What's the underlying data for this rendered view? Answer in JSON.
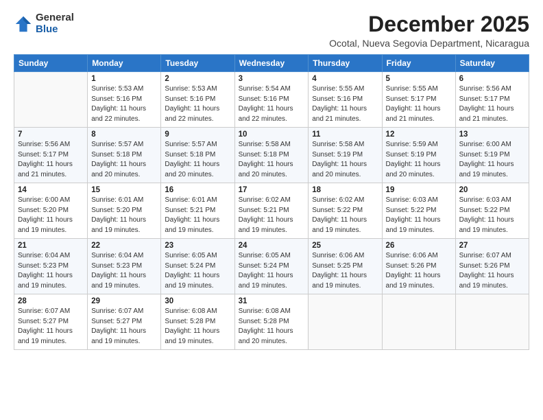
{
  "logo": {
    "general": "General",
    "blue": "Blue"
  },
  "title": "December 2025",
  "location": "Ocotal, Nueva Segovia Department, Nicaragua",
  "days_header": [
    "Sunday",
    "Monday",
    "Tuesday",
    "Wednesday",
    "Thursday",
    "Friday",
    "Saturday"
  ],
  "weeks": [
    [
      {
        "day": "",
        "info": ""
      },
      {
        "day": "1",
        "info": "Sunrise: 5:53 AM\nSunset: 5:16 PM\nDaylight: 11 hours\nand 22 minutes."
      },
      {
        "day": "2",
        "info": "Sunrise: 5:53 AM\nSunset: 5:16 PM\nDaylight: 11 hours\nand 22 minutes."
      },
      {
        "day": "3",
        "info": "Sunrise: 5:54 AM\nSunset: 5:16 PM\nDaylight: 11 hours\nand 22 minutes."
      },
      {
        "day": "4",
        "info": "Sunrise: 5:55 AM\nSunset: 5:16 PM\nDaylight: 11 hours\nand 21 minutes."
      },
      {
        "day": "5",
        "info": "Sunrise: 5:55 AM\nSunset: 5:17 PM\nDaylight: 11 hours\nand 21 minutes."
      },
      {
        "day": "6",
        "info": "Sunrise: 5:56 AM\nSunset: 5:17 PM\nDaylight: 11 hours\nand 21 minutes."
      }
    ],
    [
      {
        "day": "7",
        "info": "Sunrise: 5:56 AM\nSunset: 5:17 PM\nDaylight: 11 hours\nand 21 minutes."
      },
      {
        "day": "8",
        "info": "Sunrise: 5:57 AM\nSunset: 5:18 PM\nDaylight: 11 hours\nand 20 minutes."
      },
      {
        "day": "9",
        "info": "Sunrise: 5:57 AM\nSunset: 5:18 PM\nDaylight: 11 hours\nand 20 minutes."
      },
      {
        "day": "10",
        "info": "Sunrise: 5:58 AM\nSunset: 5:18 PM\nDaylight: 11 hours\nand 20 minutes."
      },
      {
        "day": "11",
        "info": "Sunrise: 5:58 AM\nSunset: 5:19 PM\nDaylight: 11 hours\nand 20 minutes."
      },
      {
        "day": "12",
        "info": "Sunrise: 5:59 AM\nSunset: 5:19 PM\nDaylight: 11 hours\nand 20 minutes."
      },
      {
        "day": "13",
        "info": "Sunrise: 6:00 AM\nSunset: 5:19 PM\nDaylight: 11 hours\nand 19 minutes."
      }
    ],
    [
      {
        "day": "14",
        "info": "Sunrise: 6:00 AM\nSunset: 5:20 PM\nDaylight: 11 hours\nand 19 minutes."
      },
      {
        "day": "15",
        "info": "Sunrise: 6:01 AM\nSunset: 5:20 PM\nDaylight: 11 hours\nand 19 minutes."
      },
      {
        "day": "16",
        "info": "Sunrise: 6:01 AM\nSunset: 5:21 PM\nDaylight: 11 hours\nand 19 minutes."
      },
      {
        "day": "17",
        "info": "Sunrise: 6:02 AM\nSunset: 5:21 PM\nDaylight: 11 hours\nand 19 minutes."
      },
      {
        "day": "18",
        "info": "Sunrise: 6:02 AM\nSunset: 5:22 PM\nDaylight: 11 hours\nand 19 minutes."
      },
      {
        "day": "19",
        "info": "Sunrise: 6:03 AM\nSunset: 5:22 PM\nDaylight: 11 hours\nand 19 minutes."
      },
      {
        "day": "20",
        "info": "Sunrise: 6:03 AM\nSunset: 5:22 PM\nDaylight: 11 hours\nand 19 minutes."
      }
    ],
    [
      {
        "day": "21",
        "info": "Sunrise: 6:04 AM\nSunset: 5:23 PM\nDaylight: 11 hours\nand 19 minutes."
      },
      {
        "day": "22",
        "info": "Sunrise: 6:04 AM\nSunset: 5:23 PM\nDaylight: 11 hours\nand 19 minutes."
      },
      {
        "day": "23",
        "info": "Sunrise: 6:05 AM\nSunset: 5:24 PM\nDaylight: 11 hours\nand 19 minutes."
      },
      {
        "day": "24",
        "info": "Sunrise: 6:05 AM\nSunset: 5:24 PM\nDaylight: 11 hours\nand 19 minutes."
      },
      {
        "day": "25",
        "info": "Sunrise: 6:06 AM\nSunset: 5:25 PM\nDaylight: 11 hours\nand 19 minutes."
      },
      {
        "day": "26",
        "info": "Sunrise: 6:06 AM\nSunset: 5:26 PM\nDaylight: 11 hours\nand 19 minutes."
      },
      {
        "day": "27",
        "info": "Sunrise: 6:07 AM\nSunset: 5:26 PM\nDaylight: 11 hours\nand 19 minutes."
      }
    ],
    [
      {
        "day": "28",
        "info": "Sunrise: 6:07 AM\nSunset: 5:27 PM\nDaylight: 11 hours\nand 19 minutes."
      },
      {
        "day": "29",
        "info": "Sunrise: 6:07 AM\nSunset: 5:27 PM\nDaylight: 11 hours\nand 19 minutes."
      },
      {
        "day": "30",
        "info": "Sunrise: 6:08 AM\nSunset: 5:28 PM\nDaylight: 11 hours\nand 19 minutes."
      },
      {
        "day": "31",
        "info": "Sunrise: 6:08 AM\nSunset: 5:28 PM\nDaylight: 11 hours\nand 20 minutes."
      },
      {
        "day": "",
        "info": ""
      },
      {
        "day": "",
        "info": ""
      },
      {
        "day": "",
        "info": ""
      }
    ]
  ]
}
